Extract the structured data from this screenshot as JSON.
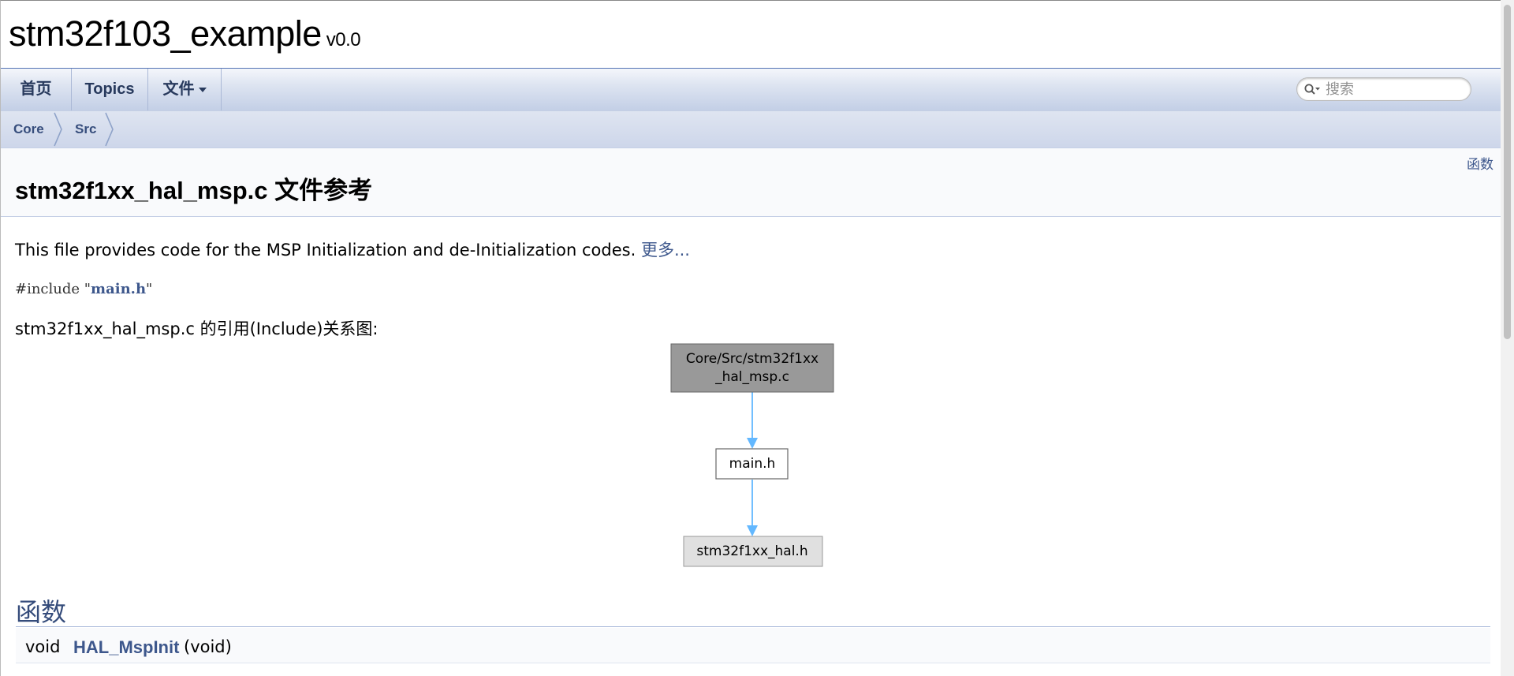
{
  "project": {
    "name": "stm32f103_example",
    "version": "v0.0"
  },
  "nav": {
    "items": [
      {
        "label": "首页"
      },
      {
        "label": "Topics"
      },
      {
        "label": "文件"
      }
    ],
    "search_placeholder": "搜索"
  },
  "breadcrumb": [
    "Core",
    "Src"
  ],
  "header": {
    "summary_link": "函数",
    "title": "stm32f1xx_hal_msp.c 文件参考"
  },
  "content": {
    "description": "This file provides code for the MSP Initialization and de-Initialization codes.",
    "more_link": "更多...",
    "include_prefix": "#include \"",
    "include_file": "main.h",
    "include_suffix": "\"",
    "graph_caption": "stm32f1xx_hal_msp.c 的引用(Include)关系图:"
  },
  "graph": {
    "nodes": [
      {
        "line1": "Core/Src/stm32f1xx",
        "line2": "_hal_msp.c"
      },
      {
        "line1": "main.h"
      },
      {
        "line1": "stm32f1xx_hal.h"
      }
    ],
    "colors": {
      "edge": "#63b8ff",
      "node_top": "#999999",
      "node_bottom": "#e0e0e0"
    }
  },
  "members": {
    "section_title": "函数",
    "rows": [
      {
        "return_type": "void",
        "name": "HAL_MspInit",
        "args": "(void)"
      }
    ]
  }
}
